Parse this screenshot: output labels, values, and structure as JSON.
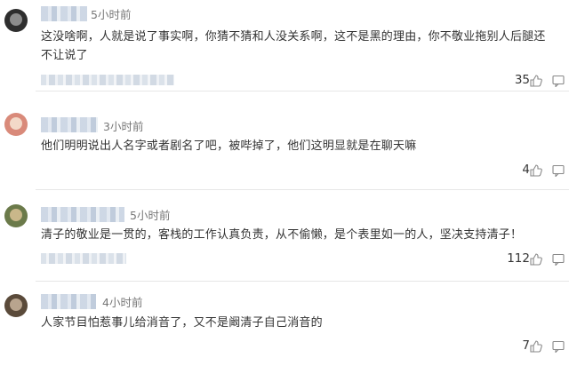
{
  "comments": [
    {
      "time": "5小时前",
      "text": "这没啥啊，人就是说了事实啊，你猜不猜和人没关系啊，这不是黑的理由，你不敬业拖别人后腿还不让说了",
      "likes": "35",
      "avatar_color": "#3a3a3a"
    },
    {
      "time": "3小时前",
      "text": "他们明明说出人名字或者剧名了吧，被哔掉了，他们这明显就是在聊天嘛",
      "likes": "4",
      "avatar_color": "#d98a7a"
    },
    {
      "time": "5小时前",
      "text": "清子的敬业是一贯的，客栈的工作认真负责，从不偷懒，是个表里如一的人，坚决支持清子！",
      "likes": "112",
      "avatar_color": "#6b7a4a"
    },
    {
      "time": "4小时前",
      "text": "人家节目怕惹事儿给消音了，又不是阚清子自己消音的",
      "likes": "7",
      "avatar_color": "#5a4a3a"
    }
  ]
}
